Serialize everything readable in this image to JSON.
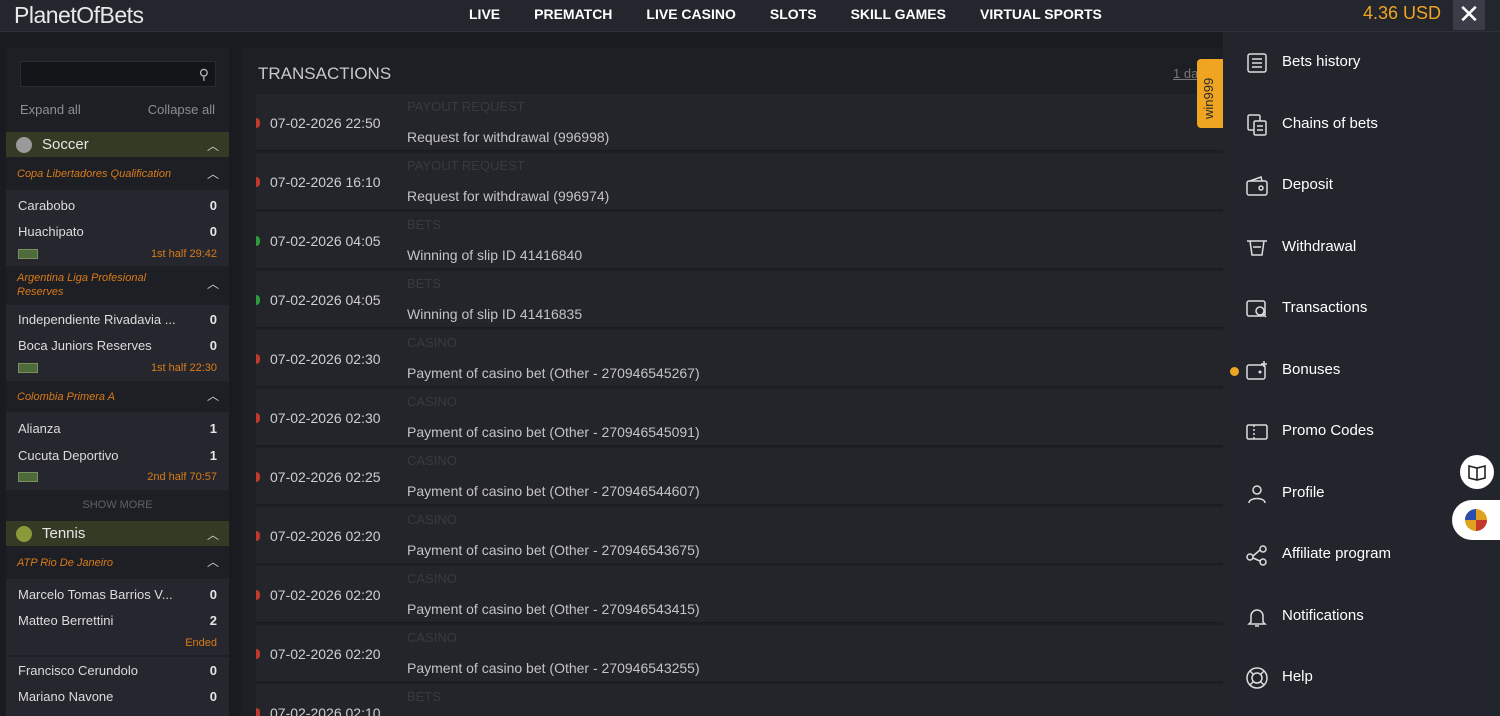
{
  "header": {
    "logo": "PlanetOfBets",
    "nav": [
      "LIVE",
      "PREMATCH",
      "LIVE CASINO",
      "SLOTS",
      "SKILL GAMES",
      "VIRTUAL SPORTS"
    ],
    "balance": "4.36 USD",
    "close": "✕"
  },
  "sidebar": {
    "search_placeholder": "",
    "expand_all": "Expand all",
    "collapse_all": "Collapse all",
    "soccer": {
      "name": "Soccer",
      "leagues": [
        {
          "name": "Copa Libertadores Qualification",
          "home": "Carabobo",
          "home_score": "0",
          "away": "Huachipato",
          "away_score": "0",
          "time": "1st half 29:42"
        },
        {
          "name": "Argentina Liga Profesional Reserves",
          "home": "Independiente Rivadavia ...",
          "home_score": "0",
          "away": "Boca Juniors Reserves",
          "away_score": "0",
          "time": "1st half 22:30"
        },
        {
          "name": "Colombia Primera A",
          "home": "Alianza",
          "home_score": "1",
          "away": "Cucuta Deportivo",
          "away_score": "1",
          "time": "2nd half 70:57"
        }
      ],
      "show_more": "SHOW MORE"
    },
    "tennis": {
      "name": "Tennis",
      "league": "ATP Rio De Janeiro",
      "m1_home": "Marcelo Tomas Barrios V...",
      "m1_home_score": "0",
      "m1_away": "Matteo Berrettini",
      "m1_away_score": "2",
      "m1_status": "Ended",
      "m2_home": "Francisco Cerundolo",
      "m2_home_score": "0",
      "m2_away": "Mariano Navone",
      "m2_away_score": "0"
    }
  },
  "transactions": {
    "title": "TRANSACTIONS",
    "period": "1 da",
    "rows": [
      {
        "datetime": "07-02-2026 22:50",
        "category": "PAYOUT REQUEST",
        "description": "Request for withdrawal (996998)",
        "status": "red"
      },
      {
        "datetime": "07-02-2026 16:10",
        "category": "PAYOUT REQUEST",
        "description": "Request for withdrawal (996974)",
        "status": "red"
      },
      {
        "datetime": "07-02-2026 04:05",
        "category": "BETS",
        "description": "Winning of slip ID 41416840",
        "status": "green"
      },
      {
        "datetime": "07-02-2026 04:05",
        "category": "BETS",
        "description": "Winning of slip ID 41416835",
        "status": "green"
      },
      {
        "datetime": "07-02-2026 02:30",
        "category": "CASINO",
        "description": "Payment of casino bet (Other - 270946545267)",
        "status": "red"
      },
      {
        "datetime": "07-02-2026 02:30",
        "category": "CASINO",
        "description": "Payment of casino bet (Other - 270946545091)",
        "status": "red"
      },
      {
        "datetime": "07-02-2026 02:25",
        "category": "CASINO",
        "description": "Payment of casino bet (Other - 270946544607)",
        "status": "red"
      },
      {
        "datetime": "07-02-2026 02:20",
        "category": "CASINO",
        "description": "Payment of casino bet (Other - 270946543675)",
        "status": "red"
      },
      {
        "datetime": "07-02-2026 02:20",
        "category": "CASINO",
        "description": "Payment of casino bet (Other - 270946543415)",
        "status": "red"
      },
      {
        "datetime": "07-02-2026 02:20",
        "category": "CASINO",
        "description": "Payment of casino bet (Other - 270946543255)",
        "status": "red"
      },
      {
        "datetime": "07-02-2026 02:10",
        "category": "BETS",
        "description": "",
        "status": "red"
      }
    ]
  },
  "promo_tab": "win999",
  "menu": {
    "items": [
      {
        "label": "Bets history",
        "icon": "list-icon"
      },
      {
        "label": "Chains of bets",
        "icon": "chain-icon"
      },
      {
        "label": "Deposit",
        "icon": "wallet-icon"
      },
      {
        "label": "Withdrawal",
        "icon": "withdrawal-icon"
      },
      {
        "label": "Transactions",
        "icon": "transactions-icon"
      },
      {
        "label": "Bonuses",
        "icon": "bonus-icon"
      },
      {
        "label": "Promo Codes",
        "icon": "promo-icon"
      },
      {
        "label": "Profile",
        "icon": "user-icon"
      },
      {
        "label": "Affiliate program",
        "icon": "share-icon"
      },
      {
        "label": "Notifications",
        "icon": "bell-icon"
      },
      {
        "label": "Help",
        "icon": "lifebuoy-icon"
      }
    ]
  },
  "colors": {
    "accent": "#f0a522",
    "league": "#d97b18",
    "red": "#c0392b",
    "green": "#2e9a3a"
  }
}
